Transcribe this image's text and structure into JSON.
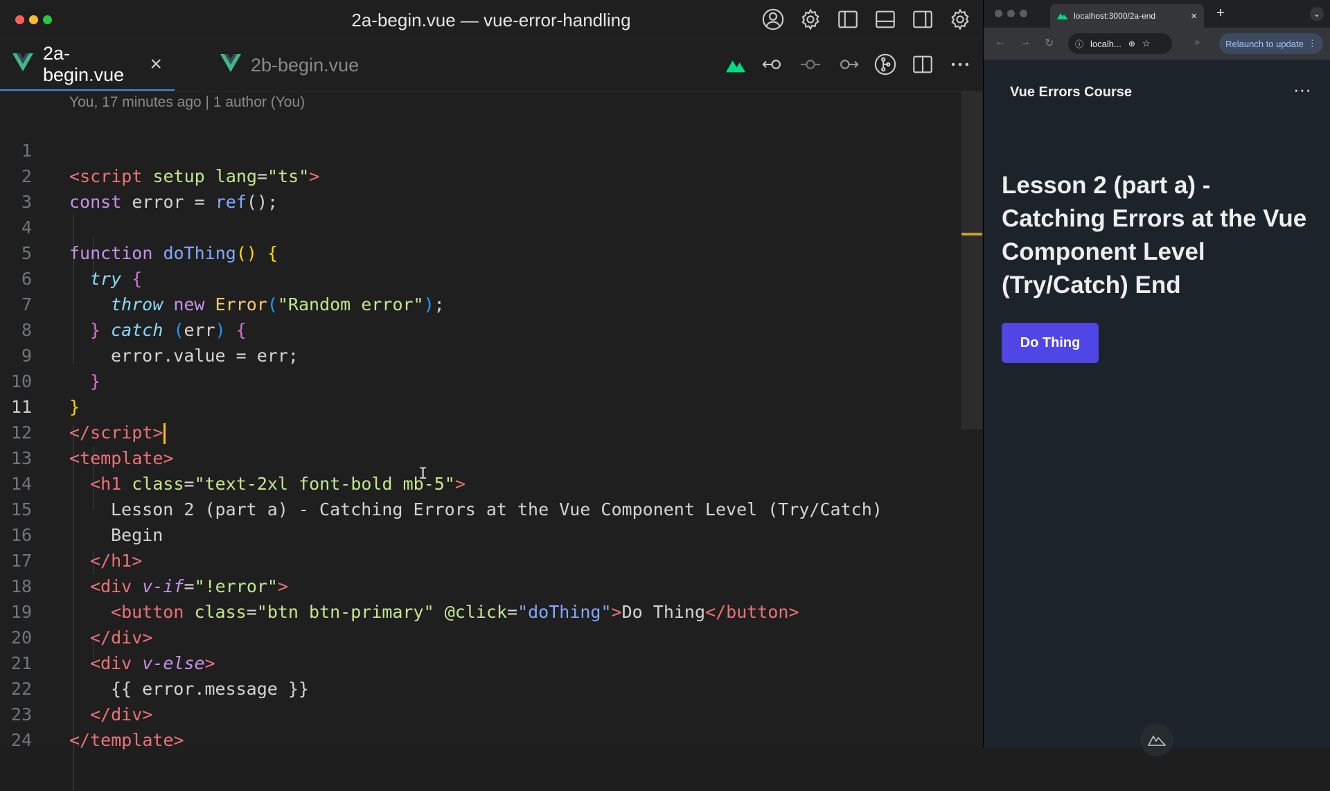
{
  "editor": {
    "window_title": "2a-begin.vue — vue-error-handling",
    "tabs": [
      {
        "label": "2a-begin.vue",
        "active": true
      },
      {
        "label": "2b-begin.vue",
        "active": false
      }
    ],
    "tab_close": "×",
    "blame": "You, 17 minutes ago | 1 author (You)",
    "line_numbers": [
      "1",
      "2",
      "3",
      "4",
      "5",
      "6",
      "7",
      "8",
      "9",
      "10",
      "11",
      "12",
      "13",
      "14",
      "15",
      "16",
      "17",
      "18",
      "19",
      "20",
      "21",
      "22",
      "23",
      "24"
    ],
    "code": {
      "l1": [
        "<",
        "script",
        " ",
        "setup",
        " ",
        "lang",
        "=",
        "\"ts\"",
        ">"
      ],
      "l2": [
        "const",
        " error = ",
        "ref",
        "();"
      ],
      "l4": [
        "function",
        " ",
        "doThing",
        "() ",
        "{"
      ],
      "l5": [
        "try",
        " ",
        "{"
      ],
      "l6": [
        "throw",
        " ",
        "new",
        " ",
        "Error",
        "(",
        "\"Random error\"",
        ")",
        ";"
      ],
      "l7": [
        "}",
        " ",
        "catch",
        " ",
        "(",
        "err",
        ")",
        " ",
        "{"
      ],
      "l8": [
        "error.value = err;"
      ],
      "l9": [
        "}"
      ],
      "l10": [
        "}"
      ],
      "l11": [
        "</",
        "script",
        ">"
      ],
      "l12": [
        "<",
        "template",
        ">"
      ],
      "l13": [
        "<",
        "h1",
        " ",
        "class",
        "=",
        "\"text-2xl font-bold mb-5\"",
        ">"
      ],
      "l14": [
        "Lesson 2 (part a) - Catching Errors at the Vue Component Level (Try/Catch)"
      ],
      "l15": [
        "Begin"
      ],
      "l16": [
        "</",
        "h1",
        ">"
      ],
      "l17": [
        "<",
        "div",
        " ",
        "v-if",
        "=",
        "\"!error\"",
        ">"
      ],
      "l18": [
        "<",
        "button",
        " ",
        "class",
        "=",
        "\"btn btn-primary\"",
        " ",
        "@click",
        "=",
        "\"doThing\"",
        ">",
        "Do Thing",
        "</",
        "button",
        ">"
      ],
      "l19": [
        "</",
        "div",
        ">"
      ],
      "l20": [
        "<",
        "div",
        " ",
        "v-else",
        ">"
      ],
      "l21": [
        "{{ error.message }}"
      ],
      "l22": [
        "</",
        "div",
        ">"
      ],
      "l23": [
        "</",
        "template",
        ">"
      ]
    },
    "icons": {
      "titlebar": [
        "account-icon",
        "settings-icon",
        "toggle-primary-sidebar-icon",
        "toggle-panel-icon",
        "toggle-secondary-sidebar-icon",
        "manage-gear-icon"
      ],
      "editor_actions": [
        "nuxt-devtools-icon",
        "go-back-icon",
        "commit-icon",
        "go-forward-icon",
        "git-compare-icon",
        "split-editor-icon",
        "more-actions-icon"
      ]
    },
    "colors": {
      "cursor": "#f0c419",
      "active_tab_indicator": "#3b8eea"
    }
  },
  "browser": {
    "tab_title": "localhost:3000/2a-end",
    "tab_close": "×",
    "new_tab": "+",
    "address": "localh...",
    "relaunch": "Relaunch to update",
    "page": {
      "brand": "Vue Errors Course",
      "menu": "···",
      "heading": "Lesson 2 (part a) - Catching Errors at the Vue Component Level (Try/Catch) End",
      "button": "Do Thing"
    },
    "colors": {
      "button_bg": "#4f46e5",
      "page_bg": "#1d232a"
    }
  }
}
